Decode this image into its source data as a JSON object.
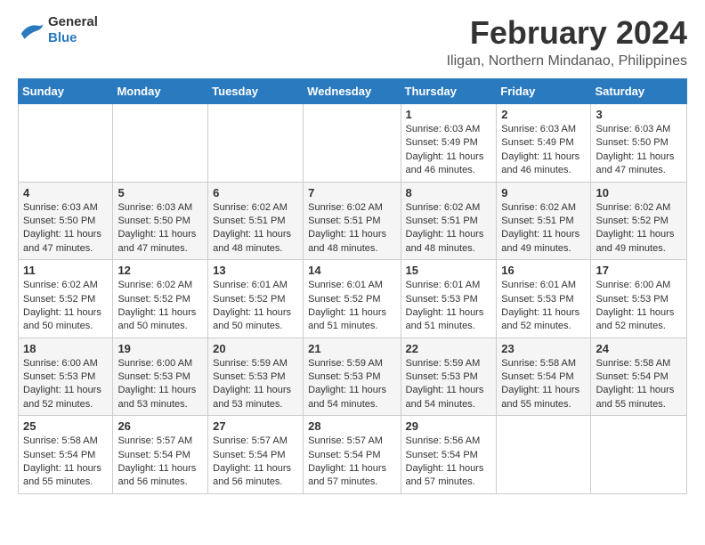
{
  "header": {
    "logo_general": "General",
    "logo_blue": "Blue",
    "title": "February 2024",
    "subtitle": "Iligan, Northern Mindanao, Philippines"
  },
  "weekdays": [
    "Sunday",
    "Monday",
    "Tuesday",
    "Wednesday",
    "Thursday",
    "Friday",
    "Saturday"
  ],
  "weeks": [
    [
      {
        "day": "",
        "info": ""
      },
      {
        "day": "",
        "info": ""
      },
      {
        "day": "",
        "info": ""
      },
      {
        "day": "",
        "info": ""
      },
      {
        "day": "1",
        "info": "Sunrise: 6:03 AM\nSunset: 5:49 PM\nDaylight: 11 hours and 46 minutes."
      },
      {
        "day": "2",
        "info": "Sunrise: 6:03 AM\nSunset: 5:49 PM\nDaylight: 11 hours and 46 minutes."
      },
      {
        "day": "3",
        "info": "Sunrise: 6:03 AM\nSunset: 5:50 PM\nDaylight: 11 hours and 47 minutes."
      }
    ],
    [
      {
        "day": "4",
        "info": "Sunrise: 6:03 AM\nSunset: 5:50 PM\nDaylight: 11 hours and 47 minutes."
      },
      {
        "day": "5",
        "info": "Sunrise: 6:03 AM\nSunset: 5:50 PM\nDaylight: 11 hours and 47 minutes."
      },
      {
        "day": "6",
        "info": "Sunrise: 6:02 AM\nSunset: 5:51 PM\nDaylight: 11 hours and 48 minutes."
      },
      {
        "day": "7",
        "info": "Sunrise: 6:02 AM\nSunset: 5:51 PM\nDaylight: 11 hours and 48 minutes."
      },
      {
        "day": "8",
        "info": "Sunrise: 6:02 AM\nSunset: 5:51 PM\nDaylight: 11 hours and 48 minutes."
      },
      {
        "day": "9",
        "info": "Sunrise: 6:02 AM\nSunset: 5:51 PM\nDaylight: 11 hours and 49 minutes."
      },
      {
        "day": "10",
        "info": "Sunrise: 6:02 AM\nSunset: 5:52 PM\nDaylight: 11 hours and 49 minutes."
      }
    ],
    [
      {
        "day": "11",
        "info": "Sunrise: 6:02 AM\nSunset: 5:52 PM\nDaylight: 11 hours and 50 minutes."
      },
      {
        "day": "12",
        "info": "Sunrise: 6:02 AM\nSunset: 5:52 PM\nDaylight: 11 hours and 50 minutes."
      },
      {
        "day": "13",
        "info": "Sunrise: 6:01 AM\nSunset: 5:52 PM\nDaylight: 11 hours and 50 minutes."
      },
      {
        "day": "14",
        "info": "Sunrise: 6:01 AM\nSunset: 5:52 PM\nDaylight: 11 hours and 51 minutes."
      },
      {
        "day": "15",
        "info": "Sunrise: 6:01 AM\nSunset: 5:53 PM\nDaylight: 11 hours and 51 minutes."
      },
      {
        "day": "16",
        "info": "Sunrise: 6:01 AM\nSunset: 5:53 PM\nDaylight: 11 hours and 52 minutes."
      },
      {
        "day": "17",
        "info": "Sunrise: 6:00 AM\nSunset: 5:53 PM\nDaylight: 11 hours and 52 minutes."
      }
    ],
    [
      {
        "day": "18",
        "info": "Sunrise: 6:00 AM\nSunset: 5:53 PM\nDaylight: 11 hours and 52 minutes."
      },
      {
        "day": "19",
        "info": "Sunrise: 6:00 AM\nSunset: 5:53 PM\nDaylight: 11 hours and 53 minutes."
      },
      {
        "day": "20",
        "info": "Sunrise: 5:59 AM\nSunset: 5:53 PM\nDaylight: 11 hours and 53 minutes."
      },
      {
        "day": "21",
        "info": "Sunrise: 5:59 AM\nSunset: 5:53 PM\nDaylight: 11 hours and 54 minutes."
      },
      {
        "day": "22",
        "info": "Sunrise: 5:59 AM\nSunset: 5:53 PM\nDaylight: 11 hours and 54 minutes."
      },
      {
        "day": "23",
        "info": "Sunrise: 5:58 AM\nSunset: 5:54 PM\nDaylight: 11 hours and 55 minutes."
      },
      {
        "day": "24",
        "info": "Sunrise: 5:58 AM\nSunset: 5:54 PM\nDaylight: 11 hours and 55 minutes."
      }
    ],
    [
      {
        "day": "25",
        "info": "Sunrise: 5:58 AM\nSunset: 5:54 PM\nDaylight: 11 hours and 55 minutes."
      },
      {
        "day": "26",
        "info": "Sunrise: 5:57 AM\nSunset: 5:54 PM\nDaylight: 11 hours and 56 minutes."
      },
      {
        "day": "27",
        "info": "Sunrise: 5:57 AM\nSunset: 5:54 PM\nDaylight: 11 hours and 56 minutes."
      },
      {
        "day": "28",
        "info": "Sunrise: 5:57 AM\nSunset: 5:54 PM\nDaylight: 11 hours and 57 minutes."
      },
      {
        "day": "29",
        "info": "Sunrise: 5:56 AM\nSunset: 5:54 PM\nDaylight: 11 hours and 57 minutes."
      },
      {
        "day": "",
        "info": ""
      },
      {
        "day": "",
        "info": ""
      }
    ]
  ]
}
